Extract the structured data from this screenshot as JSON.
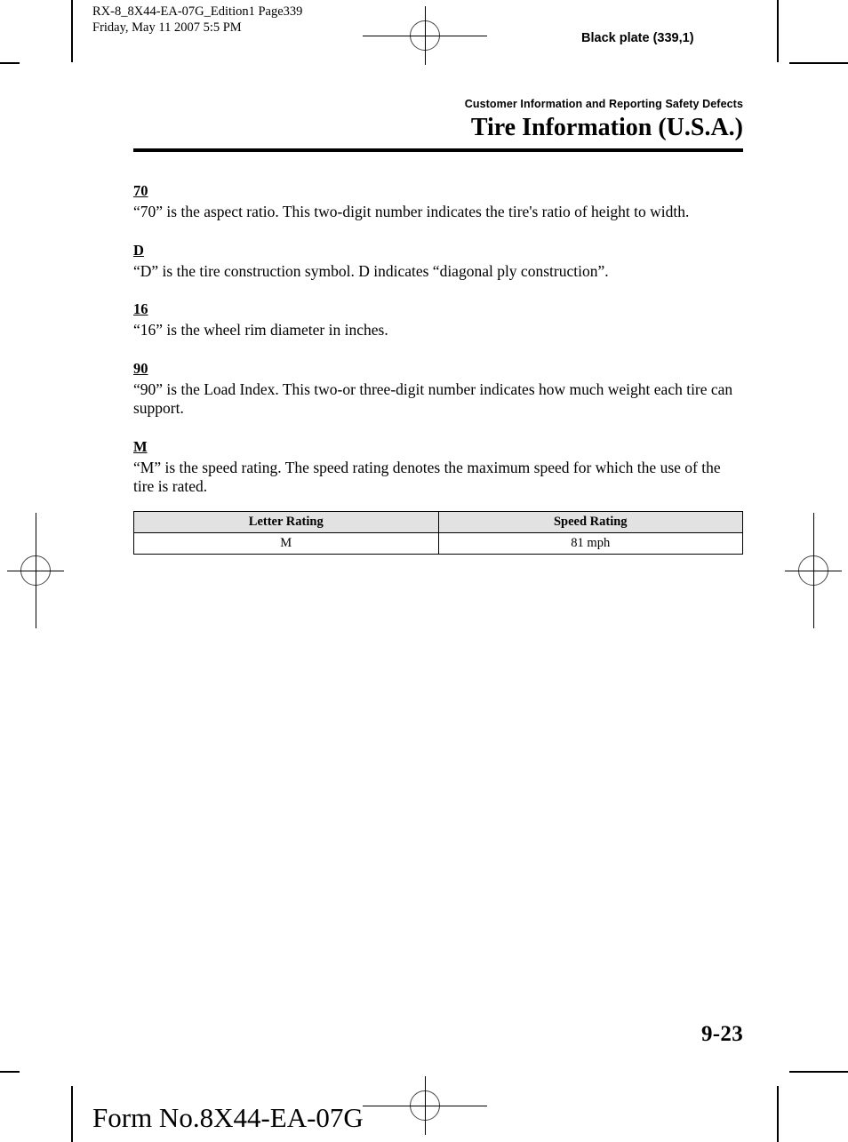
{
  "print_marks": {
    "registration_icon": "registration-target-icon",
    "crop_icon": "crop-mark-icon"
  },
  "slug": {
    "job_line1": "RX-8_8X44-EA-07G_Edition1 Page339",
    "job_line2": "Friday, May 11 2007 5:5 PM",
    "plate": "Black plate (339,1)"
  },
  "header": {
    "eyebrow": "Customer Information and Reporting Safety Defects",
    "title": "Tire Information (U.S.A.)"
  },
  "content": {
    "sections": [
      {
        "term": "70",
        "text": "“70” is the aspect ratio. This two-digit number indicates the tire's ratio of height to width."
      },
      {
        "term": "D",
        "text": "“D” is the tire construction symbol. D indicates “diagonal ply construction”."
      },
      {
        "term": "16",
        "text": "“16” is the wheel rim diameter in inches."
      },
      {
        "term": "90",
        "text": "“90” is the Load Index. This two-or three-digit number indicates how much weight each tire can support."
      },
      {
        "term": "M",
        "text": "“M” is the speed rating. The speed rating denotes the maximum speed for which the use of the tire is rated."
      }
    ]
  },
  "speed_table": {
    "headers": [
      "Letter Rating",
      "Speed Rating"
    ],
    "rows": [
      [
        "M",
        "81 mph"
      ]
    ]
  },
  "footer": {
    "folio": "9-23",
    "form_no": "Form No.8X44-EA-07G"
  },
  "colors": {
    "ink": "#000000",
    "paper": "#ffffff",
    "table_header_fill": "#e2e2e2"
  }
}
